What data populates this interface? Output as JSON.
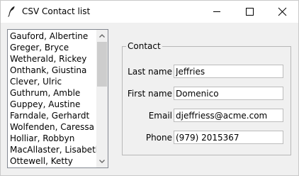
{
  "window": {
    "title": "CSV Contact list",
    "title_icon": "feather-icon",
    "controls": {
      "minimize_icon": "minimize-icon",
      "maximize_icon": "maximize-icon",
      "close_icon": "close-icon"
    }
  },
  "contact_list": {
    "items": [
      "Gauford, Albertine",
      "Greger, Bryce",
      "Wetherald, Rickey",
      "Onthank, Giustina",
      "Clever, Ulric",
      "Guthrum, Amble",
      "Guppey, Austine",
      "Farndale, Gerhardt",
      "Wolfenden, Caressa",
      "Holliar, Robbyn",
      "MacAllaster, Lisabeth",
      "Ottewell, Ketty"
    ],
    "scroll_up_icon": "chevron-up-icon",
    "scroll_down_icon": "chevron-down-icon"
  },
  "contact": {
    "group_title": "Contact",
    "fields": [
      {
        "label": "Last name",
        "value": "Jeffries"
      },
      {
        "label": "First name",
        "value": "Domenico"
      },
      {
        "label": "Email",
        "value": "djeffriess@acme.com"
      },
      {
        "label": "Phone",
        "value": "(979) 2015367"
      }
    ]
  },
  "colors": {
    "window_background": "#f0f0f0",
    "titlebar_background": "#ffffff",
    "input_border": "#bcbcbc",
    "scroll_thumb": "#cdcdcd"
  }
}
